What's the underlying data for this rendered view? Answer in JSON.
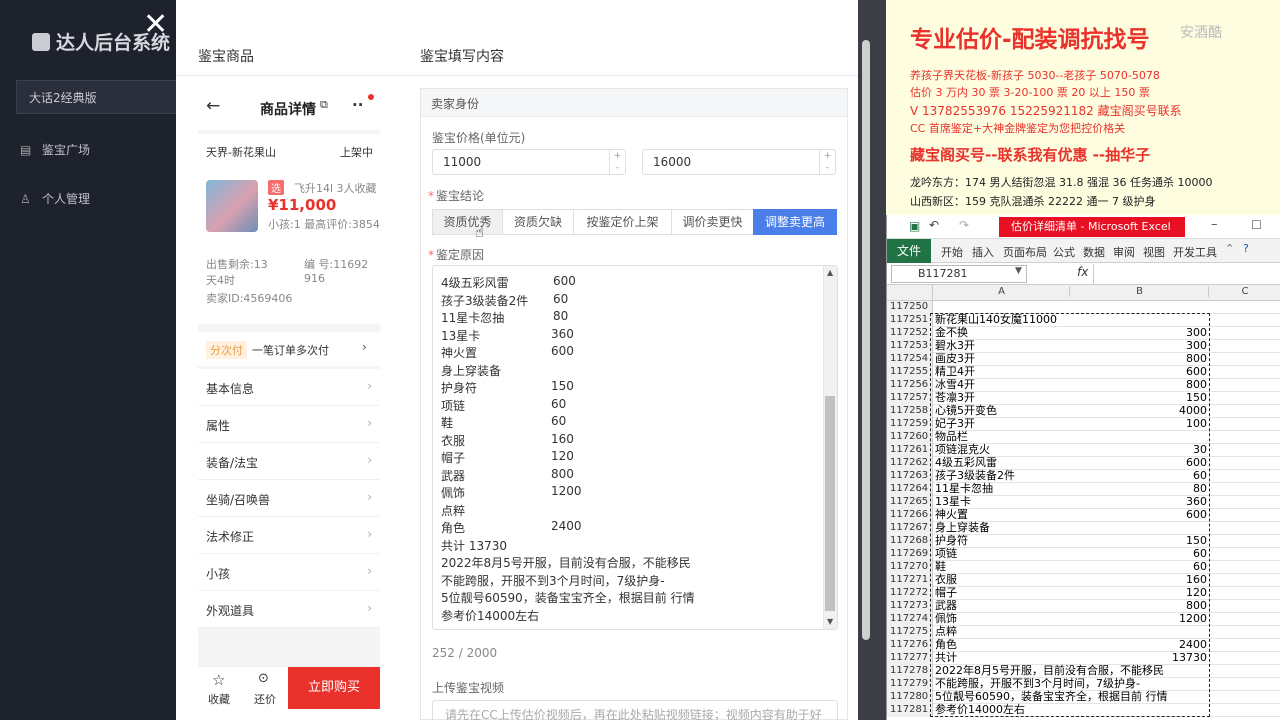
{
  "app": {
    "title": "达人后台系统",
    "game_select": "大话2经典版",
    "nav": [
      {
        "label": "鉴宝广场",
        "icon": "grid-icon"
      },
      {
        "label": "个人管理",
        "icon": "user-icon"
      }
    ]
  },
  "modal": {
    "left_header": "鉴宝商品",
    "right_header": "鉴宝填写内容"
  },
  "product": {
    "page_title": "商品详情",
    "server": "天界-新花果山",
    "status": "上架中",
    "tag": "选",
    "level_info": "飞升14l 3人收藏",
    "price": "¥11,000",
    "sub_info": "小孩:1 最高评价:3854",
    "time_left": "出售剩余:13天4时",
    "number": "编 号:11692916",
    "seller": "卖家ID:4569406",
    "installment_tag": "分次付",
    "installment_text": "一笔订单多次付",
    "menu": [
      "基本信息",
      "属性",
      "装备/法宝",
      "坐骑/召唤兽",
      "法术修正",
      "小孩",
      "外观道具"
    ],
    "bottom": {
      "fav": "收藏",
      "bargain": "还价",
      "buy": "立即购买"
    }
  },
  "form": {
    "section_title": "卖家身份",
    "price_label": "鉴宝价格(单位元)",
    "price_min": "11000",
    "price_max": "16000",
    "conclusion_label": "鉴宝结论",
    "conclusions": [
      "资质优秀",
      "资质欠缺",
      "按鉴定价上架",
      "调价卖更快",
      "调整卖更高"
    ],
    "reason_label": "鉴定原因",
    "reason_lines": [
      [
        "4级五彩风雷",
        "600"
      ],
      [
        "孩子3级装备2件",
        "60"
      ],
      [
        "11星卡忽抽",
        "80"
      ],
      [
        "13星卡",
        "360"
      ],
      [
        "神火置",
        "600"
      ],
      [
        "身上穿装备",
        ""
      ],
      [
        "护身符",
        "150"
      ],
      [
        "项链",
        "60"
      ],
      [
        "鞋",
        "60"
      ],
      [
        "衣服",
        "160"
      ],
      [
        "帽子",
        "120"
      ],
      [
        "武器",
        "800"
      ],
      [
        "佩饰",
        "1200"
      ],
      [
        "点粹",
        ""
      ],
      [
        "角色",
        "2400"
      ],
      [
        "共计 13730",
        ""
      ],
      [
        "2022年8月5号开服，目前没有合服，不能移民",
        ""
      ],
      [
        "不能跨服，开服不到3个月时间，7级护身-",
        ""
      ],
      [
        "5位靓号60590，装备宝宝齐全，根据目前 行情",
        ""
      ],
      [
        "参考价14000左右",
        ""
      ]
    ],
    "char_count": "252 / 2000",
    "video_label": "上传鉴宝视频",
    "video_placeholder": "请先在CC上传估价视频后，再在此处粘贴视频链接；视频内容有助于好"
  },
  "doc": {
    "title": "专业估价-配装调抗找号",
    "watermark": "安酒酷",
    "lines": [
      "养孩子界天花板-新孩子 5030--老孩子 5070-5078",
      "估价 3 万内 30 票   3-20-100 票      20 以上 150 票",
      "V 13782553976   15225921182   藏宝阁买号联系",
      "CC 首席鉴定+大神金牌鉴定为您把控价格关",
      "藏宝阁买号--联系我有优惠 --抽华子",
      "龙吟东方：174 男人结街忽混 31.8 强混 36 任务通杀 10000",
      "山西新区：159 克队混通杀 22222 通一 7 级护身"
    ]
  },
  "excel": {
    "title": "估价详细清单 - Microsoft Excel",
    "file_tab": "文件",
    "tabs": [
      "开始",
      "插入",
      "页面布局",
      "公式",
      "数据",
      "审阅",
      "视图",
      "开发工具"
    ],
    "name_box": "B117281",
    "fx": "fx",
    "col_headers": [
      "A",
      "B",
      "C"
    ],
    "rows": [
      [
        "117250",
        "",
        ""
      ],
      [
        "117251",
        "新花果山140女魔11000",
        ""
      ],
      [
        "117252",
        "金不换",
        "300"
      ],
      [
        "117253",
        "碧水3开",
        "300"
      ],
      [
        "117254",
        "画皮3开",
        "800"
      ],
      [
        "117255",
        "精卫4开",
        "600"
      ],
      [
        "117256",
        "冰雪4开",
        "800"
      ],
      [
        "117257",
        "苍凛3开",
        "150"
      ],
      [
        "117258",
        "心镜5开变色",
        "4000"
      ],
      [
        "117259",
        "妃子3开",
        "100"
      ],
      [
        "117260",
        "物品栏",
        ""
      ],
      [
        "117261",
        "项链混克火",
        "30"
      ],
      [
        "117262",
        "4级五彩风雷",
        "600"
      ],
      [
        "117263",
        "孩子3级装备2件",
        "60"
      ],
      [
        "117264",
        "11星卡忽抽",
        "80"
      ],
      [
        "117265",
        "13星卡",
        "360"
      ],
      [
        "117266",
        "神火置",
        "600"
      ],
      [
        "117267",
        "身上穿装备",
        ""
      ],
      [
        "117268",
        "护身符",
        "150"
      ],
      [
        "117269",
        "项链",
        "60"
      ],
      [
        "117270",
        "鞋",
        "60"
      ],
      [
        "117271",
        "衣服",
        "160"
      ],
      [
        "117272",
        "帽子",
        "120"
      ],
      [
        "117273",
        "武器",
        "800"
      ],
      [
        "117274",
        "佩饰",
        "1200"
      ],
      [
        "117275",
        "点粹",
        ""
      ],
      [
        "117276",
        "角色",
        "2400"
      ],
      [
        "117277",
        "共计",
        "13730"
      ],
      [
        "117278",
        "2022年8月5号开服，目前没有合服，不能移民",
        ""
      ],
      [
        "117279",
        "不能跨服，开服不到3个月时间，7级护身-",
        ""
      ],
      [
        "117280",
        "5位靓号60590，装备宝宝齐全，根据目前 行情",
        ""
      ],
      [
        "117281",
        "参考价14000左右",
        ""
      ]
    ]
  }
}
